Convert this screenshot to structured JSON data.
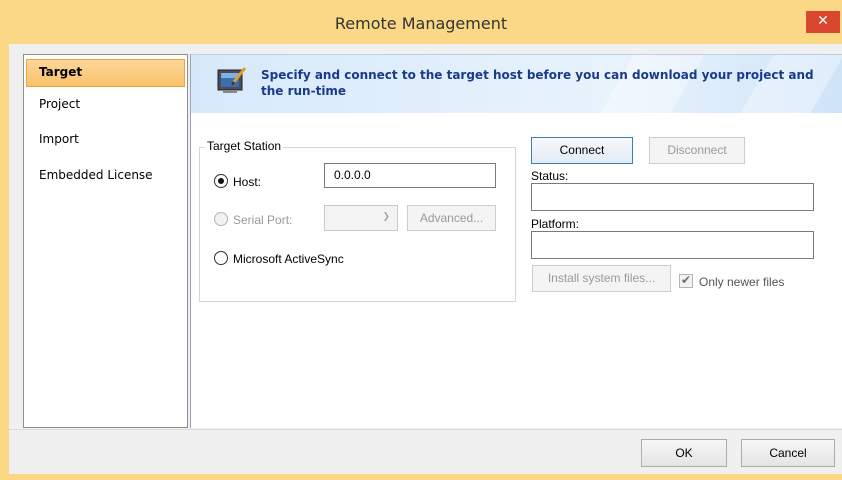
{
  "window": {
    "title": "Remote Management",
    "close_glyph": "✕"
  },
  "sidebar": {
    "items": [
      {
        "label": "Target",
        "selected": true
      },
      {
        "label": "Project",
        "selected": false
      },
      {
        "label": "Import",
        "selected": false
      },
      {
        "label": "Embedded License",
        "selected": false
      }
    ]
  },
  "banner": {
    "icon": "monitor-pen-icon",
    "text": "Specify and connect to the target host before you can download your project and the run-time"
  },
  "target_station": {
    "group_label": "Target Station",
    "host": {
      "label": "Host:",
      "value": "0.0.0.0",
      "checked": true
    },
    "serial_port": {
      "label": "Serial Port:",
      "value": "",
      "enabled": false,
      "advanced_label": "Advanced..."
    },
    "activesync": {
      "label": "Microsoft ActiveSync",
      "checked": false
    }
  },
  "connection": {
    "connect_label": "Connect",
    "disconnect_label": "Disconnect",
    "status_label": "Status:",
    "status_value": "",
    "platform_label": "Platform:",
    "platform_value": "",
    "install_label": "Install system files...",
    "only_newer_label": "Only newer files",
    "only_newer_checked": true
  },
  "footer": {
    "ok_label": "OK",
    "cancel_label": "Cancel"
  },
  "colors": {
    "title_bar": "#fbd886",
    "close_button": "#d9472e",
    "selection": "#f9c06a",
    "banner_text": "#1a3a8c"
  }
}
